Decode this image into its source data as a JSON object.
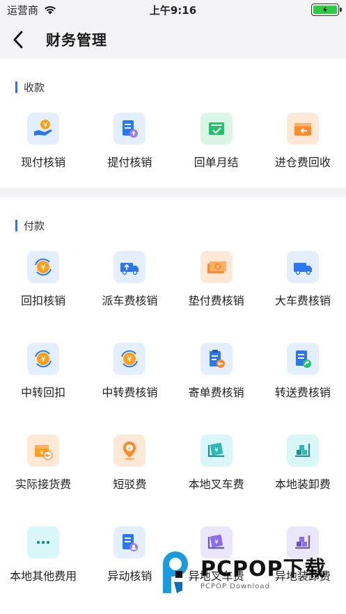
{
  "status_bar": {
    "carrier": "运营商",
    "time": "上午9:16"
  },
  "nav": {
    "title": "财务管理"
  },
  "sections": [
    {
      "title": "收款",
      "items": [
        {
          "label": "现付核销"
        },
        {
          "label": "提付核销"
        },
        {
          "label": "回单月结"
        },
        {
          "label": "进仓费回收"
        }
      ]
    },
    {
      "title": "付款",
      "items": [
        {
          "label": "回扣核销"
        },
        {
          "label": "派车费核销"
        },
        {
          "label": "垫付费核销"
        },
        {
          "label": "大车费核销"
        },
        {
          "label": "中转回扣"
        },
        {
          "label": "中转费核销"
        },
        {
          "label": "寄单费核销"
        },
        {
          "label": "转送费核销"
        },
        {
          "label": "实际接货费"
        },
        {
          "label": "短驳费"
        },
        {
          "label": "本地叉车费"
        },
        {
          "label": "本地装卸费"
        },
        {
          "label": "本地其他费用"
        },
        {
          "label": "异动核销"
        },
        {
          "label": "异地叉车费"
        },
        {
          "label": "异地装卸费"
        }
      ]
    }
  ],
  "watermark": {
    "main": "PCPOP下载",
    "sub": "PCPOP Download"
  },
  "colors": {
    "accent": "#2a77f0",
    "battery": "#2ecc40"
  }
}
